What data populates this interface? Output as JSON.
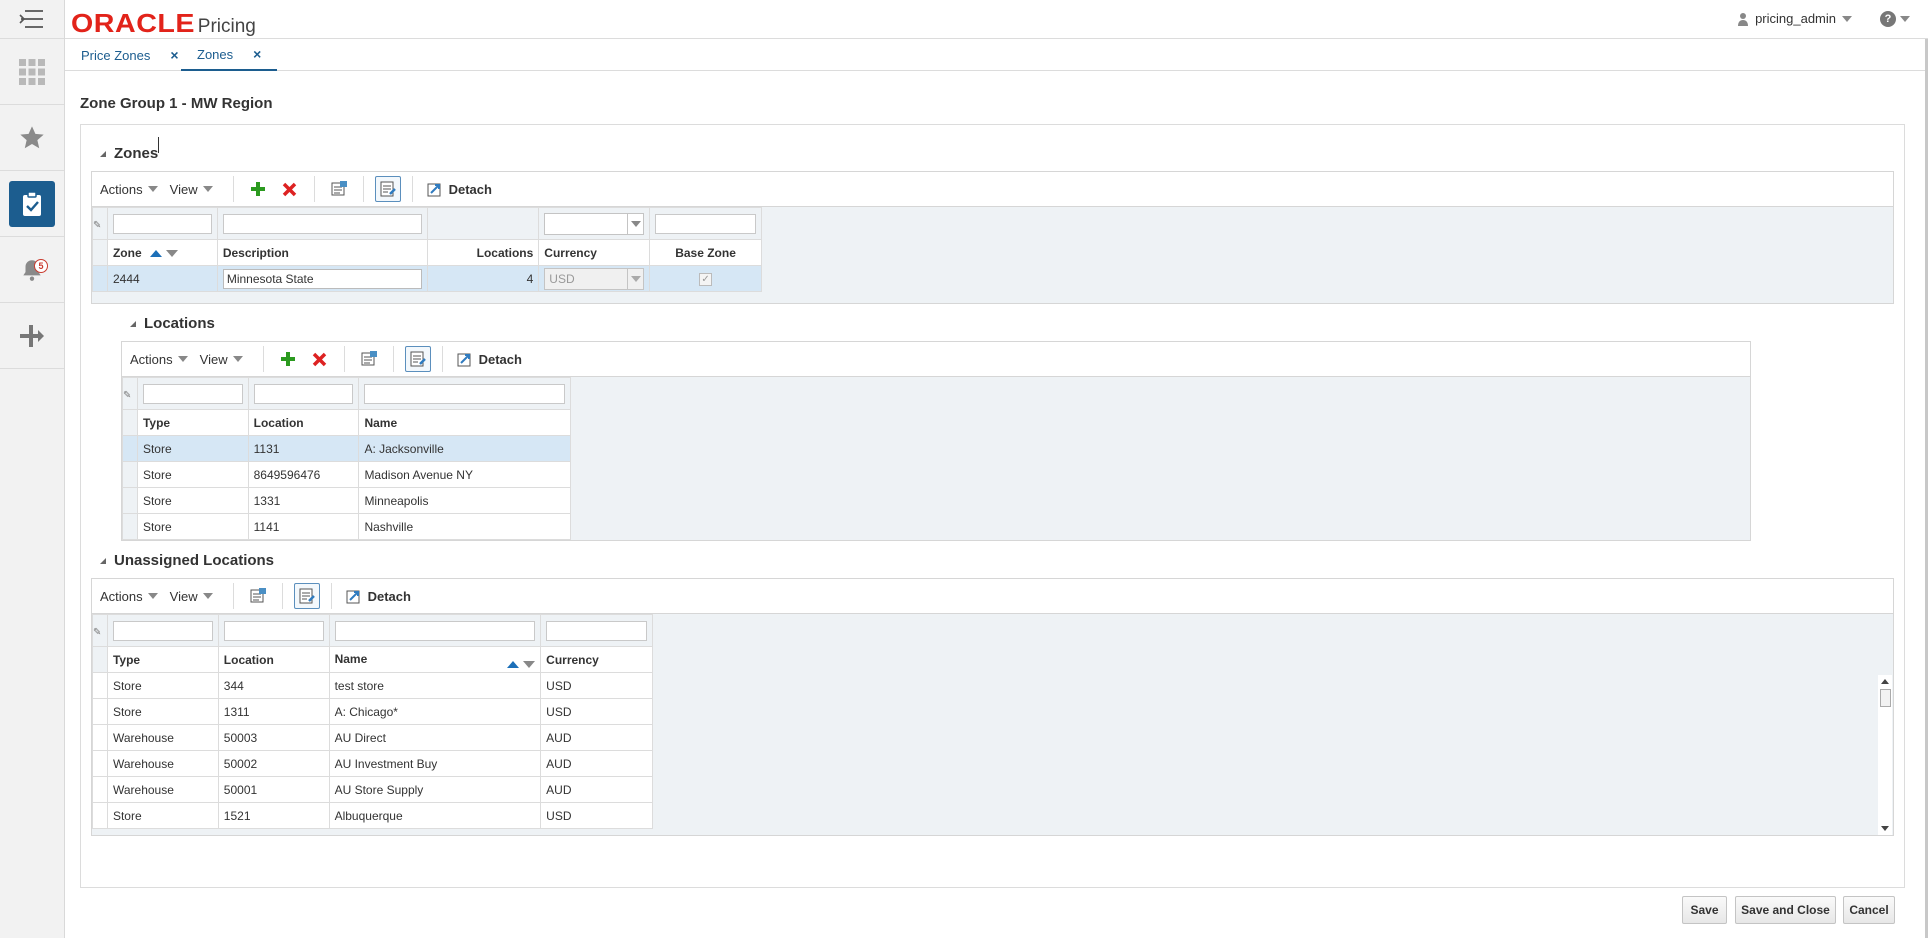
{
  "app": {
    "brand": "ORACLE",
    "title": "Pricing"
  },
  "header": {
    "user": "pricing_admin",
    "help_glyph": "?"
  },
  "rail": {
    "items": [
      "menu-icon",
      "grid-icon",
      "star-icon",
      "clipboard-check-icon",
      "bell-icon",
      "plus-arrow-icon"
    ],
    "notification_count": "5"
  },
  "tabs": [
    {
      "label": "Price Zones",
      "close": "×"
    },
    {
      "label": "Zones",
      "close": "×"
    }
  ],
  "page": {
    "title": "Zone Group 1 - MW Region"
  },
  "zones": {
    "section_title": "Zones",
    "toolbar": {
      "actions": "Actions",
      "view": "View",
      "detach": "Detach"
    },
    "columns": [
      "Zone",
      "Description",
      "Locations",
      "Currency",
      "Base Zone"
    ],
    "rows": [
      {
        "zone": "2444",
        "description": "Minnesota State",
        "locations": "4",
        "currency": "USD",
        "base_zone": "✓"
      }
    ]
  },
  "locations": {
    "section_title": "Locations",
    "toolbar": {
      "actions": "Actions",
      "view": "View",
      "detach": "Detach"
    },
    "columns": [
      "Type",
      "Location",
      "Name"
    ],
    "rows": [
      {
        "type": "Store",
        "location": "1131",
        "name": "A: Jacksonville"
      },
      {
        "type": "Store",
        "location": "8649596476",
        "name": "Madison Avenue NY"
      },
      {
        "type": "Store",
        "location": "1331",
        "name": "Minneapolis"
      },
      {
        "type": "Store",
        "location": "1141",
        "name": "Nashville"
      }
    ]
  },
  "unassigned": {
    "section_title": "Unassigned Locations",
    "toolbar": {
      "actions": "Actions",
      "view": "View",
      "detach": "Detach"
    },
    "columns": [
      "Type",
      "Location",
      "Name",
      "Currency"
    ],
    "rows": [
      {
        "type": "Store",
        "location": "344",
        "name": "test store",
        "currency": "USD"
      },
      {
        "type": "Store",
        "location": "1311",
        "name": "A: Chicago*",
        "currency": "USD"
      },
      {
        "type": "Warehouse",
        "location": "50003",
        "name": "AU Direct",
        "currency": "AUD"
      },
      {
        "type": "Warehouse",
        "location": "50002",
        "name": "AU Investment Buy",
        "currency": "AUD"
      },
      {
        "type": "Warehouse",
        "location": "50001",
        "name": "AU Store Supply",
        "currency": "AUD"
      },
      {
        "type": "Store",
        "location": "1521",
        "name": "Albuquerque",
        "currency": "USD"
      }
    ]
  },
  "footer": {
    "save": "Save",
    "save_close": "Save and Close",
    "cancel": "Cancel"
  },
  "colors": {
    "brand_red": "#e2231a",
    "accent_blue": "#1c5d8f",
    "selected_row": "#d6e7f5"
  }
}
